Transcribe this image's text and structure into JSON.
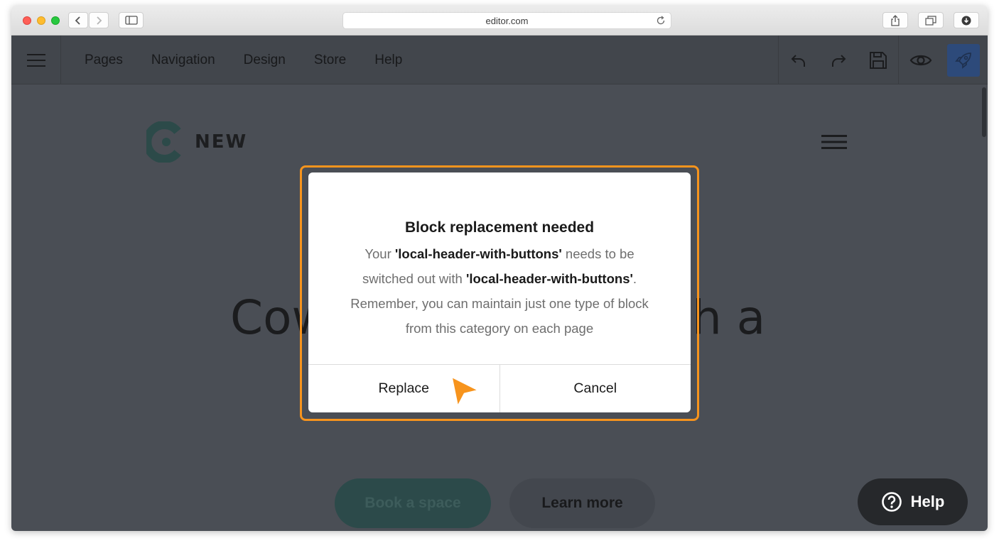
{
  "browser": {
    "url": "editor.com"
  },
  "toolbar": {
    "nav": [
      "Pages",
      "Navigation",
      "Design",
      "Store",
      "Help"
    ]
  },
  "page": {
    "logo_text": "NEW",
    "hero_left": "Cow",
    "hero_right": "h a",
    "book_button": "Book a space",
    "learn_button": "Learn more",
    "help_button": "Help"
  },
  "dialog": {
    "title": "Block replacement needed",
    "line1_prefix": "Your ",
    "block_name": "'local-header-with-buttons'",
    "line1_suffix": " needs to be",
    "line2_prefix": "switched out with ",
    "replacement_name": "'local-header-with-buttons'",
    "line2_suffix": ".",
    "line3": "Remember, you can maintain just one type of block",
    "line4": "from this category on each page",
    "replace_label": "Replace",
    "cancel_label": "Cancel"
  },
  "colors": {
    "highlight": "#f7941d",
    "publish": "#2d4a7a",
    "toolbar": "#42464c"
  }
}
